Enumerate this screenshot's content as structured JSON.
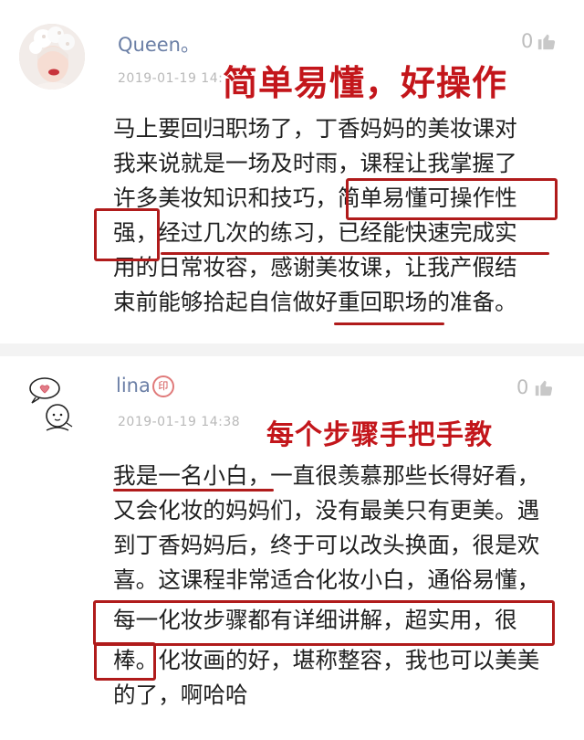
{
  "comments": [
    {
      "username": "Queen。",
      "date": "2019-01-19 14:",
      "likes": "0",
      "headline": "简单易懂，好操作",
      "lines": [
        "马上要回归职场了，丁香妈妈的美妆课对",
        "我来说就是一场及时雨，课程让我掌握了",
        "许多美妆知识和技巧，简单易懂可操作性",
        "强，经过几次的练习，已经能快速完成实",
        "用的日常妆容，感谢美妆课，让我产假结",
        "束前能够拾起自信做好重回职场的准备。"
      ]
    },
    {
      "username": "lina",
      "seal_text": "印",
      "date": "2019-01-19 14:38",
      "likes": "0",
      "headline": "每个步骤手把手教",
      "lines": [
        "我是一名小白，一直很羡慕那些长得好看，",
        "又会化妆的妈妈们，没有最美只有更美。遇",
        "到丁香妈妈后，终于可以改头换面，很是欢",
        "喜。这课程非常适合化妆小白，通俗易懂，",
        "每一化妆步骤都有详细讲解，超实用，很",
        "棒。化妆画的好，堪称整容，我也可以美美",
        "的了，啊哈哈"
      ]
    }
  ],
  "colors": {
    "username": "#6b7fa6",
    "headline": "#c3161b",
    "annotation": "#b01b1b",
    "meta": "#b9b9b9"
  },
  "icons": [
    "thumbs-up-icon",
    "avatar-photo",
    "avatar-doodle",
    "name-seal-icon"
  ]
}
